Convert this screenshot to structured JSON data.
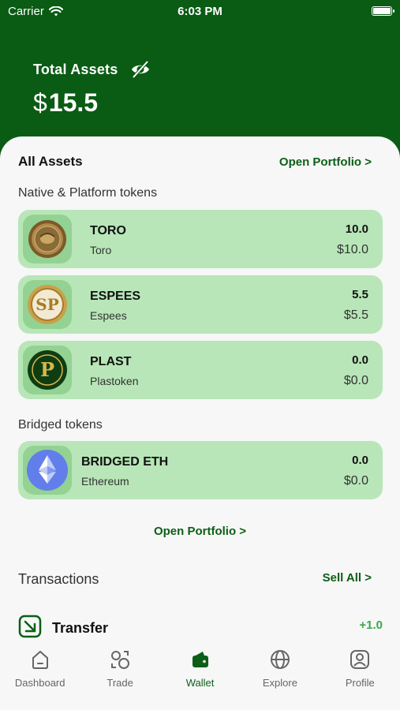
{
  "status": {
    "carrier": "Carrier",
    "time": "6:03 PM"
  },
  "header": {
    "total_label": "Total Assets",
    "currency": "$",
    "total_value": "15.5"
  },
  "assets": {
    "title": "All Assets",
    "open_portfolio_top": "Open Portfolio >",
    "native_label": "Native & Platform tokens",
    "native": [
      {
        "symbol": "TORO",
        "name": "Toro",
        "amount": "10.0",
        "value": "$10.0"
      },
      {
        "symbol": "ESPEES",
        "name": "Espees",
        "amount": "5.5",
        "value": "$5.5"
      },
      {
        "symbol": "PLAST",
        "name": "Plastoken",
        "amount": "0.0",
        "value": "$0.0"
      }
    ],
    "bridged_label": "Bridged tokens",
    "bridged": [
      {
        "symbol": "BRIDGED ETH",
        "name": "Ethereum",
        "amount": "0.0",
        "value": "$0.0"
      }
    ],
    "open_portfolio_bottom": "Open Portfolio >"
  },
  "transactions": {
    "title": "Transactions",
    "sell_all": "Sell All >",
    "items": [
      {
        "label": "Transfer",
        "amount": "+1.0"
      }
    ]
  },
  "tabs": [
    {
      "label": "Dashboard",
      "icon": "home-icon"
    },
    {
      "label": "Trade",
      "icon": "trade-icon"
    },
    {
      "label": "Wallet",
      "icon": "wallet-icon",
      "active": true
    },
    {
      "label": "Explore",
      "icon": "globe-icon"
    },
    {
      "label": "Profile",
      "icon": "profile-icon"
    }
  ],
  "colors": {
    "brand_green": "#0a5c14",
    "card_green": "#b8e6b8",
    "positive": "#3aa84a"
  }
}
